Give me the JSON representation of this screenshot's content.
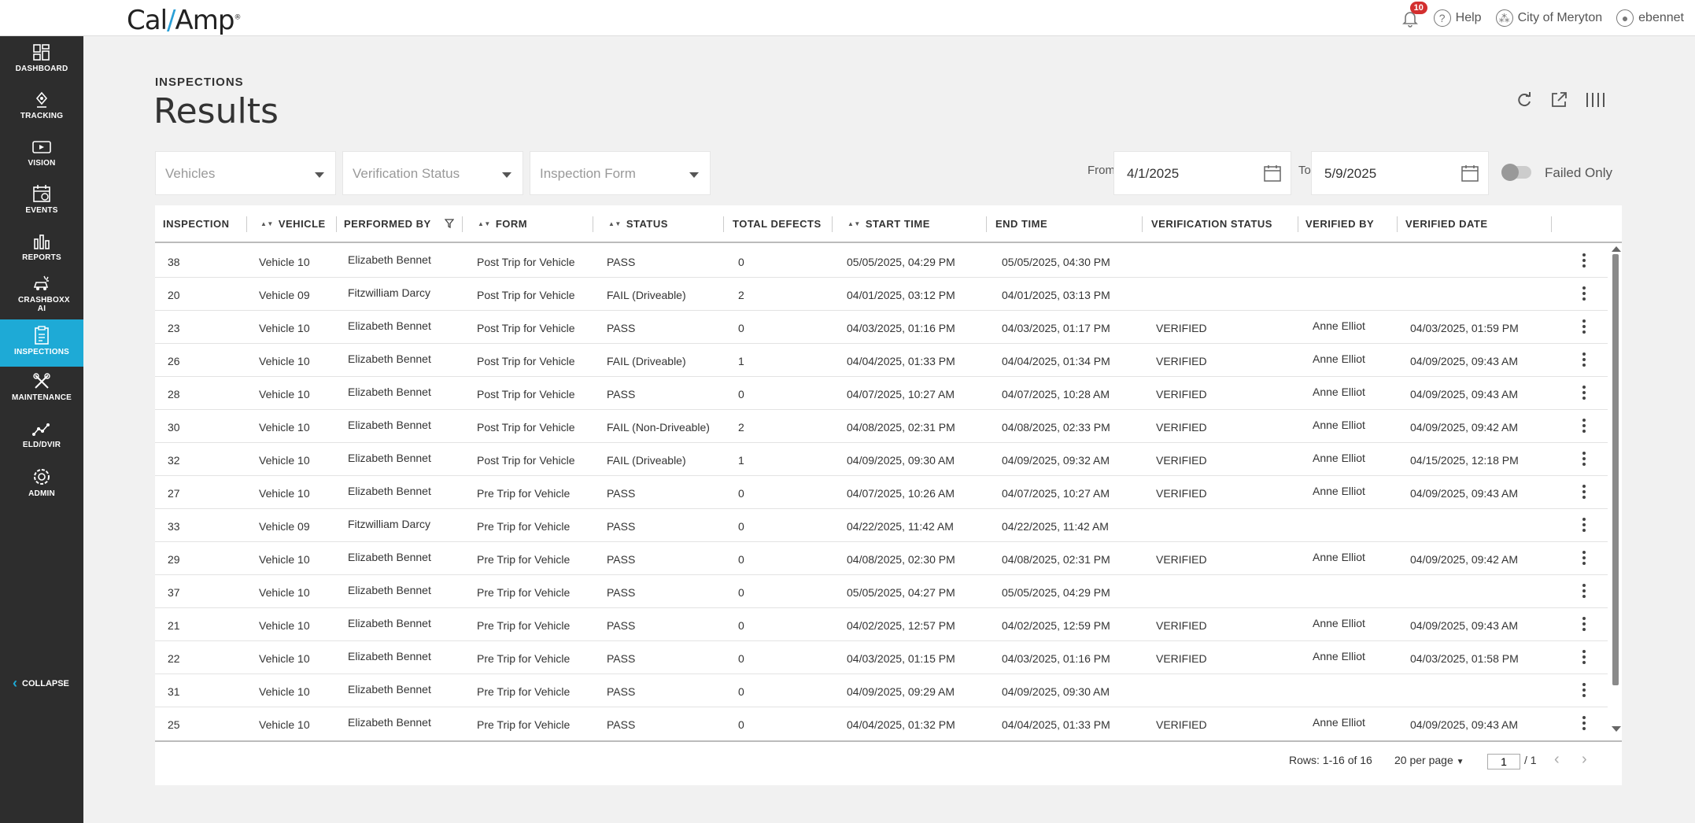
{
  "brand": {
    "left": "Cal",
    "slash": "/",
    "right": "Amp",
    "tm": "®"
  },
  "topbar": {
    "notifications": "10",
    "help": "Help",
    "organization": "City of Meryton",
    "user": "ebennet"
  },
  "sidebar": {
    "items": [
      {
        "label": "DASHBOARD",
        "icon": "dashboard-icon"
      },
      {
        "label": "TRACKING",
        "icon": "tracking-icon"
      },
      {
        "label": "VISION",
        "icon": "video-camera-icon"
      },
      {
        "label": "EVENTS",
        "icon": "events-calendar-icon"
      },
      {
        "label": "REPORTS",
        "icon": "bar-chart-icon"
      },
      {
        "label": "CRASHBOXX AI",
        "icon": "crashboxx-icon"
      },
      {
        "label": "INSPECTIONS",
        "icon": "clipboard-icon"
      },
      {
        "label": "MAINTENANCE",
        "icon": "wrench-icon"
      },
      {
        "label": "ELD/DVIR",
        "icon": "eld-line-icon"
      },
      {
        "label": "ADMIN",
        "icon": "gear-icon"
      }
    ],
    "active": "INSPECTIONS",
    "collapse": "COLLAPSE"
  },
  "header": {
    "section": "INSPECTIONS",
    "title": "Results"
  },
  "filters": {
    "vehicles": "Vehicles",
    "verification_status": "Verification Status",
    "inspection_form": "Inspection Form",
    "from_label": "From",
    "from_value": "4/1/2025",
    "to_label": "To",
    "to_value": "5/9/2025",
    "failed_only": "Failed Only"
  },
  "table": {
    "columns": [
      "INSPECTION",
      "VEHICLE",
      "PERFORMED BY",
      "FORM",
      "STATUS",
      "TOTAL DEFECTS",
      "START TIME",
      "END TIME",
      "VERIFICATION STATUS",
      "VERIFIED BY",
      "VERIFIED DATE"
    ],
    "rows": [
      [
        "38",
        "Vehicle 10",
        "Elizabeth Bennet",
        "Post Trip for Vehicle",
        "PASS",
        "0",
        "05/05/2025, 04:29 PM",
        "05/05/2025, 04:30 PM",
        "",
        "",
        ""
      ],
      [
        "20",
        "Vehicle 09",
        "Fitzwilliam Darcy",
        "Post Trip for Vehicle",
        "FAIL (Driveable)",
        "2",
        "04/01/2025, 03:12 PM",
        "04/01/2025, 03:13 PM",
        "",
        "",
        ""
      ],
      [
        "23",
        "Vehicle 10",
        "Elizabeth Bennet",
        "Post Trip for Vehicle",
        "PASS",
        "0",
        "04/03/2025, 01:16 PM",
        "04/03/2025, 01:17 PM",
        "VERIFIED",
        "Anne Elliot",
        "04/03/2025, 01:59 PM"
      ],
      [
        "26",
        "Vehicle 10",
        "Elizabeth Bennet",
        "Post Trip for Vehicle",
        "FAIL (Driveable)",
        "1",
        "04/04/2025, 01:33 PM",
        "04/04/2025, 01:34 PM",
        "VERIFIED",
        "Anne Elliot",
        "04/09/2025, 09:43 AM"
      ],
      [
        "28",
        "Vehicle 10",
        "Elizabeth Bennet",
        "Post Trip for Vehicle",
        "PASS",
        "0",
        "04/07/2025, 10:27 AM",
        "04/07/2025, 10:28 AM",
        "VERIFIED",
        "Anne Elliot",
        "04/09/2025, 09:43 AM"
      ],
      [
        "30",
        "Vehicle 10",
        "Elizabeth Bennet",
        "Post Trip for Vehicle",
        "FAIL (Non-Driveable)",
        "2",
        "04/08/2025, 02:31 PM",
        "04/08/2025, 02:33 PM",
        "VERIFIED",
        "Anne Elliot",
        "04/09/2025, 09:42 AM"
      ],
      [
        "32",
        "Vehicle 10",
        "Elizabeth Bennet",
        "Post Trip for Vehicle",
        "FAIL (Driveable)",
        "1",
        "04/09/2025, 09:30 AM",
        "04/09/2025, 09:32 AM",
        "VERIFIED",
        "Anne Elliot",
        "04/15/2025, 12:18 PM"
      ],
      [
        "27",
        "Vehicle 10",
        "Elizabeth Bennet",
        "Pre Trip for Vehicle",
        "PASS",
        "0",
        "04/07/2025, 10:26 AM",
        "04/07/2025, 10:27 AM",
        "VERIFIED",
        "Anne Elliot",
        "04/09/2025, 09:43 AM"
      ],
      [
        "33",
        "Vehicle 09",
        "Fitzwilliam Darcy",
        "Pre Trip for Vehicle",
        "PASS",
        "0",
        "04/22/2025, 11:42 AM",
        "04/22/2025, 11:42 AM",
        "",
        "",
        ""
      ],
      [
        "29",
        "Vehicle 10",
        "Elizabeth Bennet",
        "Pre Trip for Vehicle",
        "PASS",
        "0",
        "04/08/2025, 02:30 PM",
        "04/08/2025, 02:31 PM",
        "VERIFIED",
        "Anne Elliot",
        "04/09/2025, 09:42 AM"
      ],
      [
        "37",
        "Vehicle 10",
        "Elizabeth Bennet",
        "Pre Trip for Vehicle",
        "PASS",
        "0",
        "05/05/2025, 04:27 PM",
        "05/05/2025, 04:29 PM",
        "",
        "",
        ""
      ],
      [
        "21",
        "Vehicle 10",
        "Elizabeth Bennet",
        "Pre Trip for Vehicle",
        "PASS",
        "0",
        "04/02/2025, 12:57 PM",
        "04/02/2025, 12:59 PM",
        "VERIFIED",
        "Anne Elliot",
        "04/09/2025, 09:43 AM"
      ],
      [
        "22",
        "Vehicle 10",
        "Elizabeth Bennet",
        "Pre Trip for Vehicle",
        "PASS",
        "0",
        "04/03/2025, 01:15 PM",
        "04/03/2025, 01:16 PM",
        "VERIFIED",
        "Anne Elliot",
        "04/03/2025, 01:58 PM"
      ],
      [
        "31",
        "Vehicle 10",
        "Elizabeth Bennet",
        "Pre Trip for Vehicle",
        "PASS",
        "0",
        "04/09/2025, 09:29 AM",
        "04/09/2025, 09:30 AM",
        "",
        "",
        ""
      ],
      [
        "25",
        "Vehicle 10",
        "Elizabeth Bennet",
        "Pre Trip for Vehicle",
        "PASS",
        "0",
        "04/04/2025, 01:32 PM",
        "04/04/2025, 01:33 PM",
        "VERIFIED",
        "Anne Elliot",
        "04/09/2025, 09:43 AM"
      ]
    ]
  },
  "pagination": {
    "rows_text": "Rows: 1-16 of 16",
    "per_page": "20 per page",
    "page": "1",
    "total_pages": "/ 1"
  }
}
